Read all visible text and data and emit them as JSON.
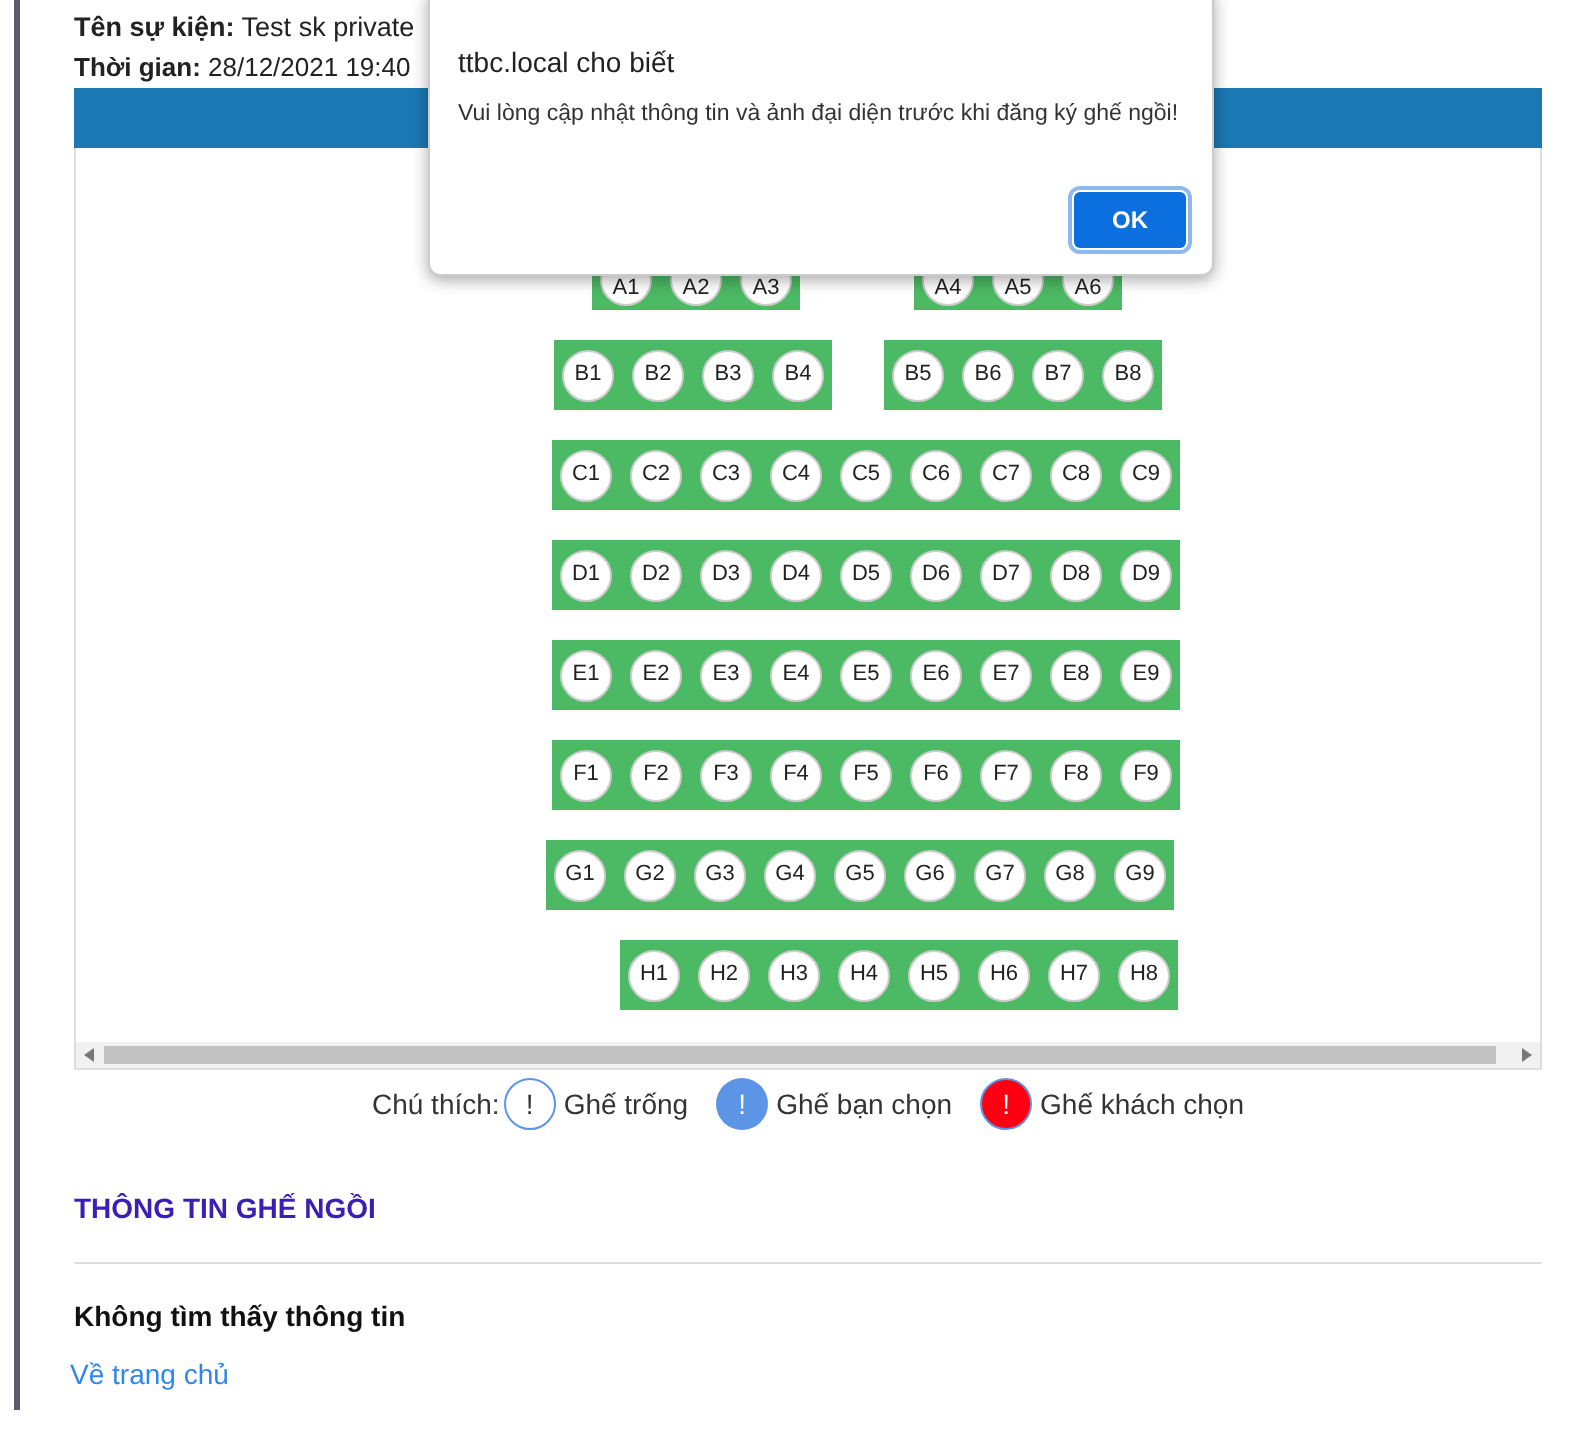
{
  "event": {
    "name_label": "Tên sự kiện:",
    "name": "Test sk private",
    "time_label": "Thời gian:",
    "time": "28/12/2021 19:40"
  },
  "seat_rows": [
    {
      "blocks": [
        [
          {
            "label": "A1",
            "kind": "empty"
          },
          {
            "label": "A2",
            "kind": "empty"
          },
          {
            "label": "A3",
            "kind": "empty"
          }
        ],
        [
          {
            "label": "A4",
            "kind": "empty"
          },
          {
            "label": "A5",
            "kind": "empty"
          },
          {
            "label": "A6",
            "kind": "empty"
          }
        ]
      ]
    },
    {
      "blocks": [
        [
          {
            "label": "B1",
            "kind": "empty"
          },
          {
            "label": "B2",
            "kind": "empty"
          },
          {
            "label": "B3",
            "kind": "empty"
          },
          {
            "label": "B4",
            "kind": "empty"
          }
        ],
        [
          {
            "label": "B5",
            "kind": "empty"
          },
          {
            "label": "B6",
            "kind": "empty"
          },
          {
            "label": "B7",
            "kind": "empty"
          },
          {
            "label": "B8",
            "kind": "empty"
          }
        ]
      ]
    },
    {
      "blocks": [
        [
          {
            "label": "C1",
            "kind": "empty"
          },
          {
            "label": "C2",
            "kind": "empty"
          },
          {
            "label": "C3",
            "kind": "empty"
          },
          {
            "label": "C4",
            "kind": "empty"
          },
          {
            "label": "C5",
            "kind": "empty"
          },
          {
            "label": "C6",
            "kind": "empty"
          },
          {
            "label": "C7",
            "kind": "empty"
          },
          {
            "label": "C8",
            "kind": "empty"
          },
          {
            "label": "C9",
            "kind": "empty"
          }
        ]
      ]
    },
    {
      "blocks": [
        [
          {
            "label": "D1",
            "kind": "empty"
          },
          {
            "label": "D2",
            "kind": "empty"
          },
          {
            "label": "D3",
            "kind": "empty"
          },
          {
            "label": "D4",
            "kind": "empty"
          },
          {
            "label": "D5",
            "kind": "empty"
          },
          {
            "label": "D6",
            "kind": "empty"
          },
          {
            "label": "D7",
            "kind": "empty"
          },
          {
            "label": "D8",
            "kind": "empty"
          },
          {
            "label": "D9",
            "kind": "empty"
          }
        ]
      ]
    },
    {
      "blocks": [
        [
          {
            "label": "E1",
            "kind": "empty"
          },
          {
            "label": "E2",
            "kind": "empty"
          },
          {
            "label": "E3",
            "kind": "empty"
          },
          {
            "label": "E4",
            "kind": "empty"
          },
          {
            "label": "E5",
            "kind": "empty"
          },
          {
            "label": "E6",
            "kind": "empty"
          },
          {
            "label": "E7",
            "kind": "empty"
          },
          {
            "label": "E8",
            "kind": "empty"
          },
          {
            "label": "E9",
            "kind": "empty"
          }
        ]
      ]
    },
    {
      "blocks": [
        [
          {
            "label": "F1",
            "kind": "empty"
          },
          {
            "label": "F2",
            "kind": "empty"
          },
          {
            "label": "F3",
            "kind": "empty"
          },
          {
            "label": "F4",
            "kind": "empty"
          },
          {
            "label": "F5",
            "kind": "empty"
          },
          {
            "label": "F6",
            "kind": "empty"
          },
          {
            "label": "F7",
            "kind": "empty"
          },
          {
            "label": "F8",
            "kind": "empty"
          },
          {
            "label": "F9",
            "kind": "empty"
          }
        ]
      ]
    },
    {
      "blocks": [
        [
          {
            "label": "G1",
            "kind": "empty"
          },
          {
            "label": "G2",
            "kind": "empty"
          },
          {
            "label": "G3",
            "kind": "empty"
          },
          {
            "label": "G4",
            "kind": "empty"
          },
          {
            "label": "G5",
            "kind": "empty"
          },
          {
            "label": "G6",
            "kind": "empty"
          },
          {
            "label": "G7",
            "kind": "empty"
          },
          {
            "label": "G8",
            "kind": "empty"
          },
          {
            "label": "G9",
            "kind": "empty"
          }
        ]
      ]
    },
    {
      "blocks": [
        [
          {
            "label": "H1",
            "kind": "empty"
          },
          {
            "label": "H2",
            "kind": "empty"
          },
          {
            "label": "H3",
            "kind": "empty"
          },
          {
            "label": "H4",
            "kind": "empty"
          },
          {
            "label": "H5",
            "kind": "empty"
          },
          {
            "label": "H6",
            "kind": "empty"
          },
          {
            "label": "H7",
            "kind": "empty"
          },
          {
            "label": "H8",
            "kind": "empty"
          }
        ]
      ]
    }
  ],
  "legend": {
    "label": "Chú thích:",
    "items": [
      {
        "kind": "empty",
        "symbol": "!",
        "text": "Ghế trống"
      },
      {
        "kind": "mine",
        "symbol": "!",
        "text": "Ghế bạn chọn"
      },
      {
        "kind": "taken",
        "symbol": "!",
        "text": "Ghế khách chọn"
      }
    ]
  },
  "seat_info": {
    "title": "THÔNG TIN GHẾ NGỒI",
    "message": "Không tìm thấy thông tin",
    "link": "Về trang chủ"
  },
  "dialog": {
    "title": "ttbc.local cho biết",
    "message": "Vui lòng cập nhật thông tin và ảnh đại diện trước khi đăng ký ghế ngồi!",
    "button": "OK"
  }
}
